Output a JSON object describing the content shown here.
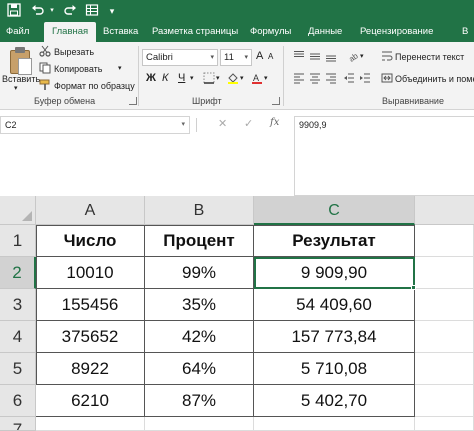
{
  "qat": {
    "save_icon": "save-icon",
    "undo_icon": "undo-icon",
    "redo_icon": "redo-icon",
    "customize_icon": "customize-icon"
  },
  "ribbon_tabs": [
    {
      "label": "Файл"
    },
    {
      "label": "Главная"
    },
    {
      "label": "Вставка"
    },
    {
      "label": "Разметка страницы"
    },
    {
      "label": "Формулы"
    },
    {
      "label": "Данные"
    },
    {
      "label": "Рецензирование"
    },
    {
      "label": "В"
    }
  ],
  "clipboard": {
    "paste_label": "Вставить",
    "cut_label": "Вырезать",
    "copy_label": "Копировать",
    "format_painter_label": "Формат по образцу",
    "group_label": "Буфер обмена"
  },
  "font": {
    "font_name": "Calibri",
    "font_size": "11",
    "bold": "Ж",
    "italic": "К",
    "underline": "Ч",
    "grow": "A",
    "shrink": "A",
    "group_label": "Шрифт"
  },
  "alignment": {
    "wrap_text_label": "Перенести текст",
    "merge_label": "Объединить и помес",
    "group_label": "Выравнивание"
  },
  "formula_bar": {
    "name_box": "C2",
    "formula_value": "9909,9"
  },
  "grid": {
    "columns": [
      "A",
      "B",
      "C"
    ],
    "rows": [
      "1",
      "2",
      "3",
      "4",
      "5",
      "6",
      "7"
    ],
    "headers": [
      "Число",
      "Процент",
      "Результат"
    ],
    "data": [
      [
        "10010",
        "99%",
        "9 909,90"
      ],
      [
        "155456",
        "35%",
        "54 409,60"
      ],
      [
        "375652",
        "42%",
        "157 773,84"
      ],
      [
        "8922",
        "64%",
        "5 710,08"
      ],
      [
        "6210",
        "87%",
        "5 402,70"
      ]
    ],
    "active_cell": "C2"
  },
  "colors": {
    "accent": "#217346",
    "ribbon_bg": "#f3f3f3",
    "header_bg": "#e6e6e6"
  }
}
